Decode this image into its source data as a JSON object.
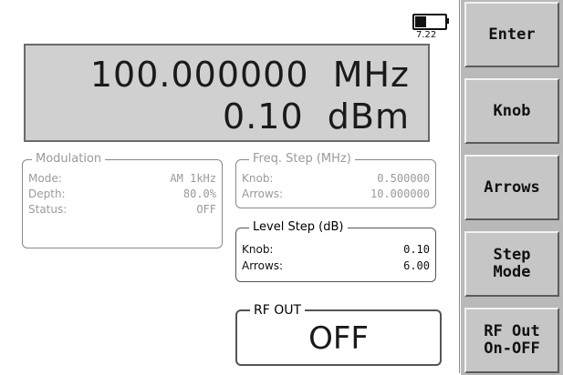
{
  "status": {
    "battery_voltage": "7.22",
    "battery_icon": "battery-icon"
  },
  "readout": {
    "frequency": "100.000000  MHz",
    "level": "0.10  dBm"
  },
  "modulation": {
    "title": "Modulation",
    "rows": [
      {
        "label": "Mode:",
        "value": "AM 1kHz"
      },
      {
        "label": "Depth:",
        "value": "80.0%"
      },
      {
        "label": "Status:",
        "value": "OFF"
      }
    ]
  },
  "freq_step": {
    "title": "Freq. Step (MHz)",
    "rows": [
      {
        "label": "Knob:",
        "value": "0.500000"
      },
      {
        "label": "Arrows:",
        "value": "10.000000"
      }
    ]
  },
  "level_step": {
    "title": "Level Step (dB)",
    "rows": [
      {
        "label": "Knob:",
        "value": "0.10"
      },
      {
        "label": "Arrows:",
        "value": "6.00"
      }
    ]
  },
  "rf_out": {
    "title": "RF OUT",
    "state": "OFF"
  },
  "softkeys": [
    "Enter",
    "Knob",
    "Arrows",
    "Step\nMode",
    "RF Out\nOn-OFF"
  ]
}
